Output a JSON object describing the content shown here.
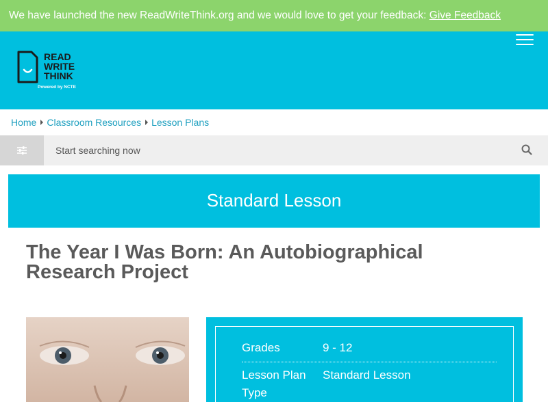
{
  "banner": {
    "text": "We have launched the new ReadWriteThink.org and we would love to get your feedback: ",
    "link_label": "Give Feedback"
  },
  "header": {
    "logo_line1": "READ",
    "logo_line2": "WRITE",
    "logo_line3": "THINK",
    "logo_tagline": "Powered by NCTE",
    "menu_icon": "hamburger-icon"
  },
  "breadcrumb": [
    "Home",
    "Classroom Resources",
    "Lesson Plans"
  ],
  "search": {
    "placeholder": "Start searching now",
    "filter_icon": "sliders-icon",
    "search_icon": "search-icon"
  },
  "lesson_type_banner": "Standard Lesson",
  "page_title": "The Year I Was Born: An Autobiographical Research Project",
  "info": {
    "grades_label": "Grades",
    "grades_value": "9 - 12",
    "type_label": "Lesson Plan Type",
    "type_value": "Standard Lesson"
  },
  "colors": {
    "banner_green": "#8cd46c",
    "brand_cyan": "#00bfdf",
    "link_teal": "#1d9fbf",
    "title_gray": "#5a5a5a"
  }
}
